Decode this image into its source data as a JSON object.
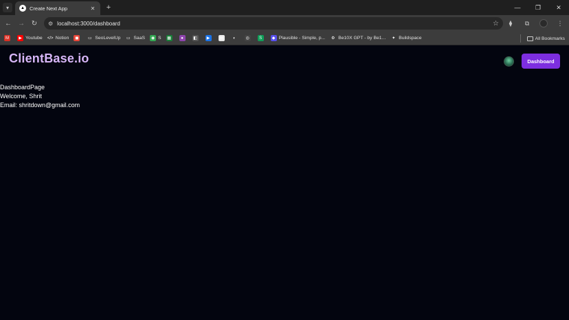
{
  "browser": {
    "tab_title": "Create Next App",
    "url": "localhost:3000/dashboard",
    "bookmarks": [
      {
        "label": "",
        "icon": "gmail-icon",
        "color": "#d93025",
        "glyph": "M"
      },
      {
        "label": "Youtube",
        "icon": "youtube-icon",
        "color": "#ff0000",
        "glyph": "▶"
      },
      {
        "label": "Notion",
        "icon": "code-icon",
        "color": "#3c3c3c",
        "glyph": "</>"
      },
      {
        "label": "",
        "icon": "app-icon",
        "color": "#e8473a",
        "glyph": "◼"
      },
      {
        "label": "SeoLevelUp",
        "icon": "folder-icon",
        "color": "#3c3c3c",
        "glyph": "▭"
      },
      {
        "label": "SaaS",
        "icon": "folder-icon",
        "color": "#3c3c3c",
        "glyph": "▭"
      },
      {
        "label": "S",
        "icon": "chrome-icon",
        "color": "#34a853",
        "glyph": "◉"
      },
      {
        "label": "",
        "icon": "sheets-icon",
        "color": "#188038",
        "glyph": "▦"
      },
      {
        "label": "",
        "icon": "app-icon",
        "color": "#8e44ad",
        "glyph": "●"
      },
      {
        "label": "",
        "icon": "app-icon",
        "color": "#555555",
        "glyph": "◧"
      },
      {
        "label": "",
        "icon": "app-icon",
        "color": "#1a73e8",
        "glyph": "▶"
      },
      {
        "label": "",
        "icon": "doc-icon",
        "color": "#e8e8e8",
        "glyph": "▤"
      },
      {
        "label": "",
        "icon": "github-icon",
        "color": "#3c3c3c",
        "glyph": "◐"
      },
      {
        "label": "",
        "icon": "app-icon",
        "color": "#444444",
        "glyph": "◎"
      },
      {
        "label": "",
        "icon": "app-icon",
        "color": "#0f9d58",
        "glyph": "S"
      },
      {
        "label": "Plausible - Simple, p...",
        "icon": "plausible-icon",
        "color": "#5850ec",
        "glyph": "◆"
      },
      {
        "label": "Be10X GPT - by Be1...",
        "icon": "gpt-icon",
        "color": "#3c3c3c",
        "glyph": "⚙"
      },
      {
        "label": "Buildspace",
        "icon": "buildspace-icon",
        "color": "#3c3c3c",
        "glyph": "✦"
      }
    ],
    "all_bookmarks_label": "All Bookmarks"
  },
  "header": {
    "logo": "ClientBase.io",
    "dashboard_button": "Dashboard"
  },
  "main": {
    "lines": [
      "DashboardPage",
      "Welcome, Shrit",
      "Email: shritdown@gmail.com"
    ]
  },
  "colors": {
    "accent": "#7d2ee0",
    "logo": "#d7b6f7",
    "background": "#03050f"
  }
}
